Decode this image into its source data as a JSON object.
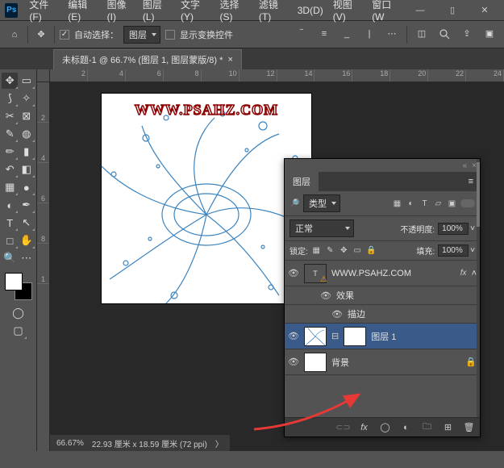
{
  "menu": [
    "文件(F)",
    "编辑(E)",
    "图像(I)",
    "图层(L)",
    "文字(Y)",
    "选择(S)",
    "滤镜(T)",
    "3D(D)",
    "视图(V)",
    "窗口(W"
  ],
  "options": {
    "auto_select_label": "自动选择：",
    "auto_select_target": "图层",
    "show_transform": "显示变换控件"
  },
  "doc_tab": {
    "title": "未标题-1 @ 66.7% (图层 1, 图层蒙版/8) *"
  },
  "ruler_h": [
    "2",
    "4",
    "6",
    "8",
    "10",
    "12",
    "14",
    "16",
    "18",
    "20",
    "22",
    "24"
  ],
  "ruler_v": [
    "2",
    "4",
    "6",
    "8",
    "1"
  ],
  "watermark": "WWW.PSAHZ.COM",
  "status": {
    "zoom": "66.67%",
    "dims": "22.93 厘米 x 18.59 厘米 (72 ppi)"
  },
  "layers_panel": {
    "tab": "图层",
    "filter_label": "类型",
    "blend_mode": "正常",
    "opacity_label": "不透明度:",
    "opacity_value": "100%",
    "lock_label": "锁定:",
    "fill_label": "填充:",
    "fill_value": "100%",
    "items": [
      {
        "name": "WWW.PSAHZ.COM",
        "fx": "fx",
        "type": "text"
      },
      {
        "name": "效果",
        "type": "sub"
      },
      {
        "name": "描边",
        "type": "sub2"
      },
      {
        "name": "图层 1",
        "type": "masked",
        "selected": true
      },
      {
        "name": "背景",
        "type": "bg",
        "locked": true
      }
    ]
  }
}
